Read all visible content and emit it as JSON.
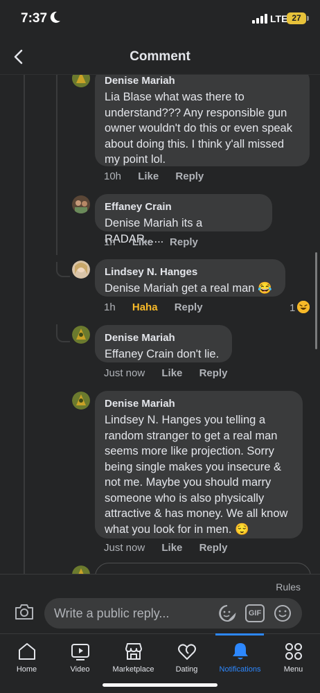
{
  "status_bar": {
    "time": "7:37",
    "network": "LTE",
    "battery": "27"
  },
  "header": {
    "title": "Comment"
  },
  "comments": [
    {
      "author": "Denise Mariah",
      "text": "Lia Blase what was there to understand??? Any responsible gun owner wouldn't do this or even speak about doing this. I think y'all missed my point lol.",
      "time": "10h",
      "like": "Like",
      "reply": "Reply"
    },
    {
      "author": "Effaney Crain",
      "text": "Denise Mariah its a RADAR......",
      "time": "1h",
      "like": "Like",
      "reply": "Reply"
    },
    {
      "author": "Lindsey N. Hanges",
      "text": "Denise Mariah get a real man 😂",
      "time": "1h",
      "like": "Haha",
      "reply": "Reply",
      "reaction_count": "1"
    },
    {
      "author": "Denise Mariah",
      "text": "Effaney Crain don't lie.",
      "time": "Just now",
      "like": "Like",
      "reply": "Reply"
    },
    {
      "author": "Denise Mariah",
      "text": "Lindsey N. Hanges you telling a random stranger to get a real man seems more like projection. Sorry being single makes you insecure & not me. Maybe you should marry someone who is also physically attractive & has money. We all know what you look for in men. 😌",
      "time": "Just now",
      "like": "Like",
      "reply": "Reply"
    }
  ],
  "composer": {
    "rules": "Rules",
    "placeholder": "Write a public reply...",
    "gif_label": "GIF"
  },
  "tabs": [
    {
      "label": "Home",
      "icon": "home-icon"
    },
    {
      "label": "Video",
      "icon": "video-icon"
    },
    {
      "label": "Marketplace",
      "icon": "marketplace-icon"
    },
    {
      "label": "Dating",
      "icon": "dating-icon"
    },
    {
      "label": "Notifications",
      "icon": "bell-icon",
      "active": true
    },
    {
      "label": "Menu",
      "icon": "menu-icon"
    }
  ],
  "colors": {
    "accent": "#2d88ff",
    "haha": "#f7b928",
    "bubble": "#3a3b3c",
    "background": "#242526"
  }
}
